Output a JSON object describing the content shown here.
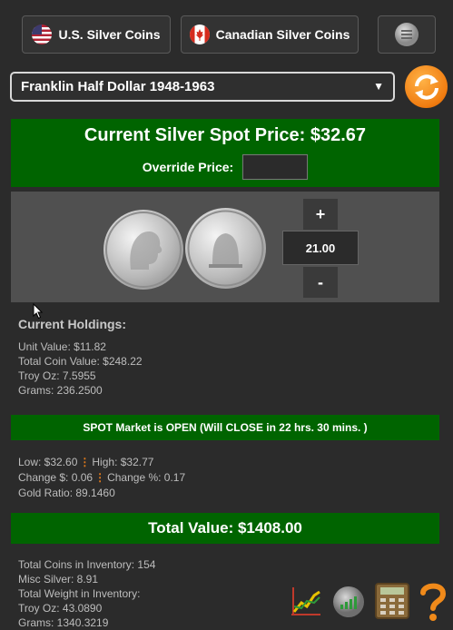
{
  "nav": {
    "us_label": "U.S. Silver Coins",
    "ca_label": "Canadian Silver Coins"
  },
  "coin_select": {
    "value": "Franklin Half Dollar 1948-1963"
  },
  "spot": {
    "title": "Current Silver Spot Price: $32.67",
    "override_label": "Override Price:",
    "override_value": ""
  },
  "quantity": {
    "plus": "+",
    "minus": "-",
    "value": "21.00"
  },
  "holdings": {
    "heading": "Current Holdings:",
    "unit_value": "Unit Value: $11.82",
    "total_coin_value": "Total Coin Value: $248.22",
    "troy_oz": "Troy Oz: 7.5955",
    "grams": "Grams: 236.2500"
  },
  "market": {
    "status": "SPOT Market is OPEN (Will CLOSE in 22 hrs. 30 mins. )",
    "low": "Low: $32.60",
    "high": "High: $32.77",
    "change_dollar": "Change $: 0.06",
    "change_pct": "Change %: 0.17",
    "gold_ratio": "Gold Ratio: 89.1460"
  },
  "total": {
    "label": "Total Value: $1408.00"
  },
  "inventory": {
    "total_coins": "Total Coins in Inventory: 154",
    "misc_silver": "Misc Silver: 8.91",
    "total_weight": "Total Weight in Inventory:",
    "troy_oz": "Troy Oz: 43.0890",
    "grams": "Grams: 1340.3219"
  },
  "colors": {
    "accent_green": "#006400",
    "refresh_orange": "#f07c10",
    "help_orange": "#f08a1a"
  },
  "icons": [
    "us-flag-icon",
    "canada-flag-icon",
    "menu-icon",
    "chevron-down-icon",
    "refresh-icon",
    "chart-icon",
    "signal-icon",
    "calculator-icon",
    "help-icon"
  ]
}
